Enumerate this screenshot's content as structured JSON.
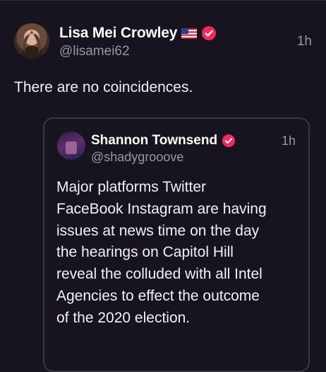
{
  "post": {
    "author_name": "Lisa Mei Crowley",
    "handle": "@lisamei62",
    "timestamp": "1h",
    "text": "There are no coincidences.",
    "flag_icon": "us-flag-icon",
    "verified_icon": "verified-badge-icon"
  },
  "quoted_post": {
    "author_name": "Shannon Townsend",
    "handle": "@shadygrooove",
    "timestamp": "1h",
    "text_lines": [
      "Major platforms Twitter",
      "FaceBook Instagram are having",
      "issues at news time on the day",
      "the hearings on Capitol Hill",
      "reveal the colluded with all Intel",
      "Agencies to effect the outcome",
      "of the 2020 election."
    ]
  },
  "colors": {
    "background": "#17141f",
    "verified_badge": "#f5285f",
    "secondary_text": "#9a96a6",
    "quote_border": "#3a3646"
  }
}
